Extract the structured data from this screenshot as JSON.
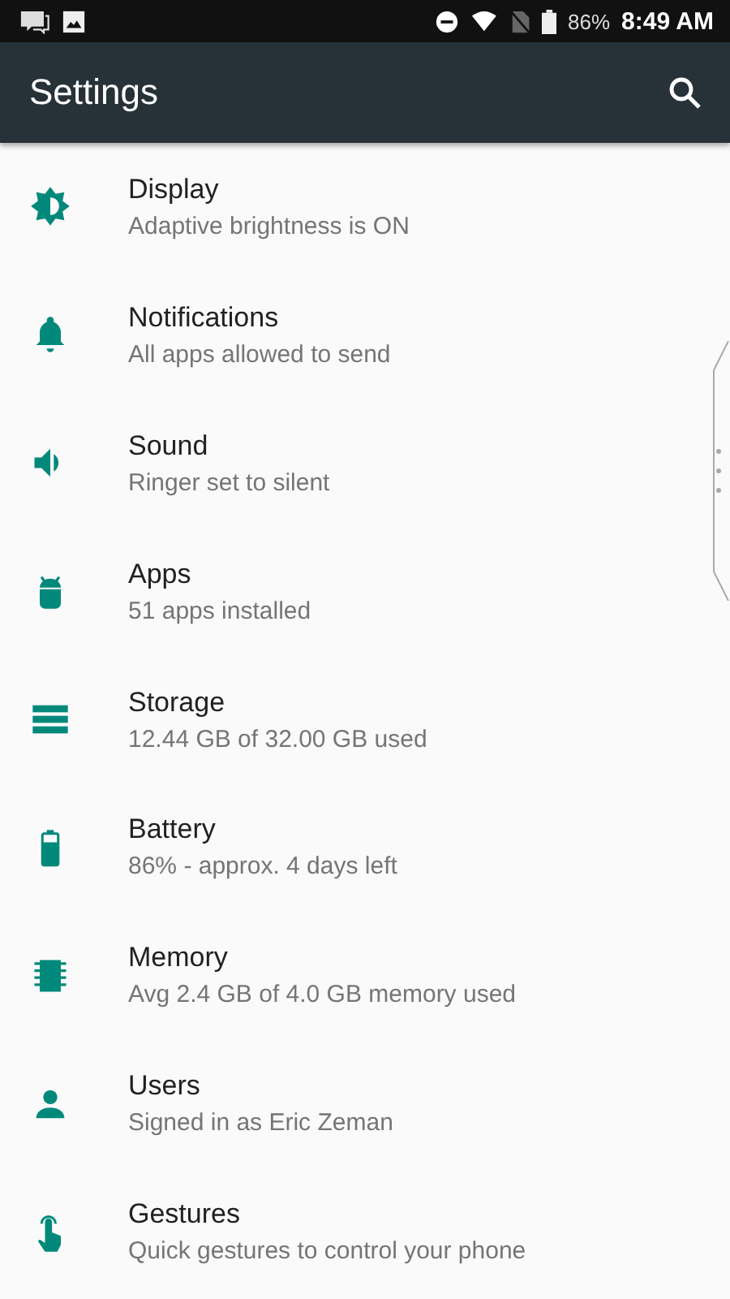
{
  "status_bar": {
    "battery": "86%",
    "time": "8:49 AM"
  },
  "toolbar": {
    "title": "Settings"
  },
  "items": [
    {
      "kind": "display",
      "title": "Display",
      "summary": "Adaptive brightness is ON"
    },
    {
      "kind": "notifications",
      "title": "Notifications",
      "summary": "All apps allowed to send"
    },
    {
      "kind": "sound",
      "title": "Sound",
      "summary": "Ringer set to silent"
    },
    {
      "kind": "apps",
      "title": "Apps",
      "summary": "51 apps installed"
    },
    {
      "kind": "storage",
      "title": "Storage",
      "summary": "12.44 GB of 32.00 GB used"
    },
    {
      "kind": "battery",
      "title": "Battery",
      "summary": "86% - approx. 4 days left"
    },
    {
      "kind": "memory",
      "title": "Memory",
      "summary": "Avg 2.4 GB of 4.0 GB memory used"
    },
    {
      "kind": "users",
      "title": "Users",
      "summary": "Signed in as Eric Zeman"
    },
    {
      "kind": "gestures",
      "title": "Gestures",
      "summary": "Quick gestures to control your phone"
    }
  ]
}
